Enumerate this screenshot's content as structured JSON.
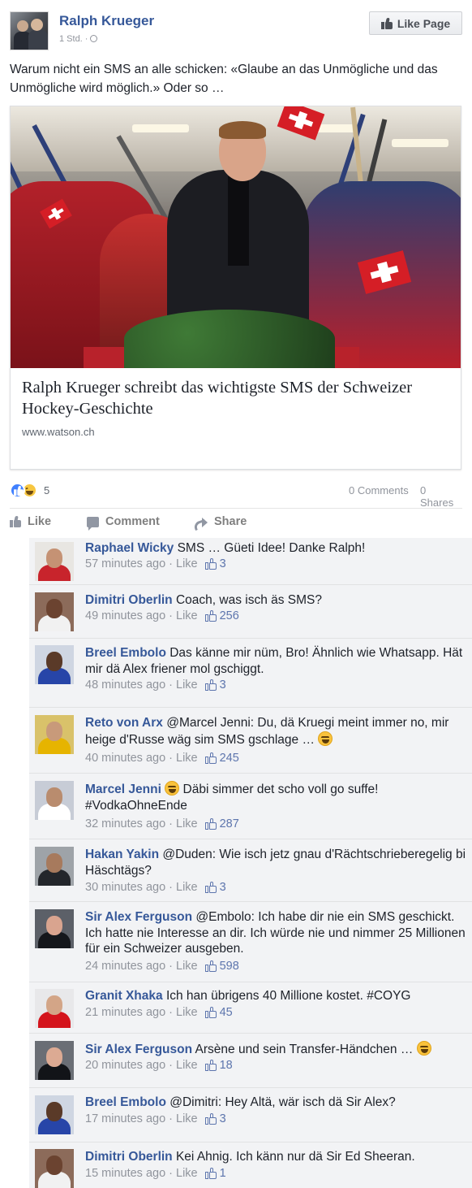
{
  "post": {
    "page_name": "Ralph Krueger",
    "time": "1 Std. ·",
    "like_page_label": "Like Page",
    "text": "Warum nicht ein SMS an alle schicken: «Glaube an das Unmögliche und das Unmögliche wird möglich.» Oder so …"
  },
  "link": {
    "title": "Ralph Krueger schreibt das wichtigste SMS der Schweizer Hockey-Geschichte",
    "domain": "www.watson.ch"
  },
  "stats": {
    "reactions_count": "5",
    "comments": "0 Comments",
    "shares": "0 Shares"
  },
  "actions": {
    "like": "Like",
    "comment": "Comment",
    "share": "Share"
  },
  "comments": [
    {
      "author": "Raphael Wicky",
      "text": "SMS … Güeti Idee! Danke Ralph!",
      "time": "57 minutes ago",
      "like": "Like",
      "likes": "3"
    },
    {
      "author": "Dimitri Oberlin",
      "text": "Coach, was isch äs SMS?",
      "time": "49 minutes ago",
      "like": "Like",
      "likes": "256"
    },
    {
      "author": "Breel Embolo",
      "text": "Das känne mir nüm, Bro! Ähnlich wie Whatsapp. Hät mir dä Alex friener mol gschiggt.",
      "time": "48 minutes ago",
      "like": "Like",
      "likes": "3"
    },
    {
      "author": "Reto von Arx",
      "text": "@Marcel Jenni: Du, dä Kruegi meint immer no, mir heige d'Russe wäg sim SMS gschlage …",
      "time": "40 minutes ago",
      "like": "Like",
      "likes": "245"
    },
    {
      "author": "Marcel Jenni",
      "text": "Däbi simmer det scho voll go suffe! #VodkaOhneEnde",
      "time": "32 minutes ago",
      "like": "Like",
      "likes": "287"
    },
    {
      "author": "Hakan Yakin",
      "text": "@Duden: Wie isch jetz gnau d'Rächtschrieberegelig bi Häschtägs?",
      "time": "30 minutes ago",
      "like": "Like",
      "likes": "3"
    },
    {
      "author": "Sir Alex Ferguson",
      "text": "@Embolo: Ich habe dir nie ein SMS geschickt. Ich hatte nie Interesse an dir. Ich würde nie und nimmer 25 Millionen für ein Schweizer ausgeben.",
      "time": "24 minutes ago",
      "like": "Like",
      "likes": "598"
    },
    {
      "author": "Granit Xhaka",
      "text": "Ich han übrigens 40 Millione kostet. #COYG",
      "time": "21 minutes ago",
      "like": "Like",
      "likes": "45"
    },
    {
      "author": "Sir Alex Ferguson",
      "text": "Arsène und sein Transfer-Händchen …",
      "time": "20 minutes ago",
      "like": "Like",
      "likes": "18"
    },
    {
      "author": "Breel Embolo",
      "text": "@Dimitri: Hey Altä, wär isch dä Sir Alex?",
      "time": "17 minutes ago",
      "like": "Like",
      "likes": "3"
    },
    {
      "author": "Dimitri Oberlin",
      "text": "Kei Ahnig. Ich känn nur dä Sir Ed Sheeran.",
      "time": "15 minutes ago",
      "like": "Like",
      "likes": "1"
    }
  ],
  "colors": {
    "link_blue": "#365899",
    "meta_gray": "#90949c",
    "comment_bg": "#f2f3f5",
    "like_blue": "#4080ff"
  }
}
